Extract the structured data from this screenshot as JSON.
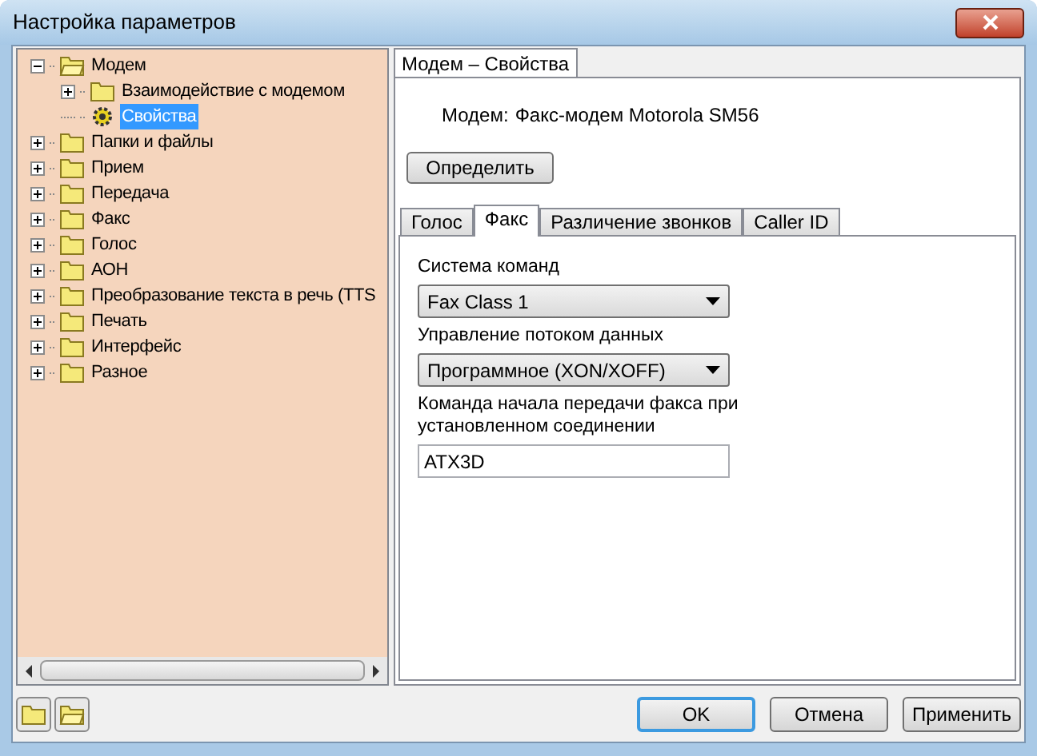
{
  "window": {
    "title": "Настройка параметров"
  },
  "tree": [
    {
      "label": "Модем",
      "kind": "folder",
      "expanded": true,
      "selected": false,
      "children": [
        {
          "label": "Взаимодействие с модемом",
          "kind": "folder",
          "expanded": false,
          "selected": false
        },
        {
          "label": "Свойства",
          "kind": "settings",
          "selected": true
        }
      ]
    },
    {
      "label": "Папки и файлы",
      "kind": "folder",
      "expanded": false,
      "selected": false
    },
    {
      "label": "Прием",
      "kind": "folder",
      "expanded": false,
      "selected": false
    },
    {
      "label": "Передача",
      "kind": "folder",
      "expanded": false,
      "selected": false
    },
    {
      "label": "Факс",
      "kind": "folder",
      "expanded": false,
      "selected": false
    },
    {
      "label": "Голос",
      "kind": "folder",
      "expanded": false,
      "selected": false
    },
    {
      "label": "АОН",
      "kind": "folder",
      "expanded": false,
      "selected": false
    },
    {
      "label": "Преобразование текста в речь (TTS",
      "kind": "folder",
      "expanded": false,
      "selected": false
    },
    {
      "label": "Печать",
      "kind": "folder",
      "expanded": false,
      "selected": false
    },
    {
      "label": "Интерфейс",
      "kind": "folder",
      "expanded": false,
      "selected": false
    },
    {
      "label": "Разное",
      "kind": "folder",
      "expanded": false,
      "selected": false
    }
  ],
  "page_tab": {
    "label": "Модем – Свойства"
  },
  "modem": {
    "label": "Модем:",
    "value": "Факс-модем Motorola SM56"
  },
  "detect_button": "Определить",
  "tabs": [
    {
      "label": "Голос",
      "selected": false
    },
    {
      "label": "Факс",
      "selected": true
    },
    {
      "label": "Различение звонков",
      "selected": false
    },
    {
      "label": "Caller ID",
      "selected": false
    }
  ],
  "fields": [
    {
      "kind": "select",
      "label": "Система команд",
      "value": "Fax Class 1"
    },
    {
      "kind": "select",
      "label": "Управление потоком данных",
      "value": "Программное (XON/XOFF)"
    },
    {
      "kind": "text",
      "label": "Команда начала передачи факса при установленном соединении",
      "value": "ATX3D"
    }
  ],
  "buttons": [
    {
      "label": "OK",
      "focused": true
    },
    {
      "label": "Отмена",
      "focused": false
    },
    {
      "label": "Применить",
      "focused": false
    }
  ]
}
